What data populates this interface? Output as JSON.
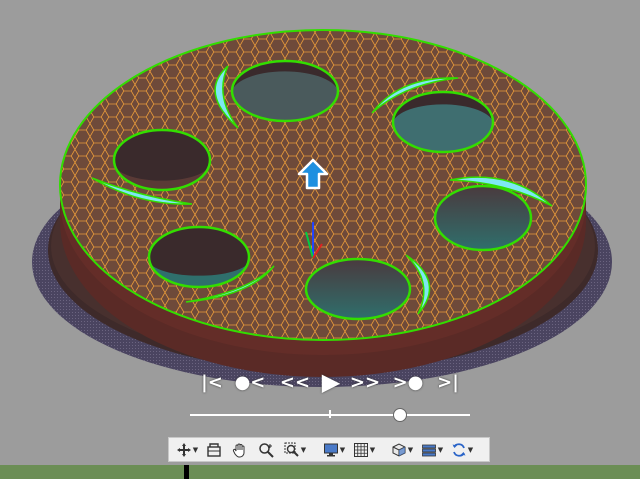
{
  "viewport": {
    "background": "#9c9c9c",
    "model": {
      "body_color": "#5a2a26",
      "mesh_line_color": "#e89a3a",
      "outline_color": "#33dd00",
      "highlight_color": "#7ee8f2",
      "shadow_color": "#4a4460"
    },
    "orientation_arrow_icon": "arrow-up-icon"
  },
  "playback": {
    "controls": [
      {
        "name": "go-to-start-button",
        "icon": "skip-to-start-icon",
        "glyph": "|<"
      },
      {
        "name": "previous-key-button",
        "icon": "previous-key-icon",
        "glyph": "●<"
      },
      {
        "name": "rewind-button",
        "icon": "rewind-icon",
        "glyph": "<<"
      },
      {
        "name": "play-button",
        "icon": "play-icon",
        "glyph": "▶"
      },
      {
        "name": "fast-forward-button",
        "icon": "fast-forward-icon",
        "glyph": ">>"
      },
      {
        "name": "next-key-button",
        "icon": "next-key-icon",
        "glyph": ">●"
      },
      {
        "name": "go-to-end-button",
        "icon": "skip-to-end-icon",
        "glyph": ">|"
      }
    ],
    "position": 0.75
  },
  "toolbar": {
    "buttons": [
      {
        "name": "pan-orbit-button",
        "icon": "move-icon",
        "has_menu": true
      },
      {
        "name": "section-view-button",
        "icon": "section-box-icon",
        "has_menu": false
      },
      {
        "name": "pan-button",
        "icon": "hand-icon",
        "has_menu": false
      },
      {
        "name": "zoom-button",
        "icon": "zoom-icon",
        "has_menu": false
      },
      {
        "name": "zoom-window-button",
        "icon": "zoom-window-icon",
        "has_menu": true
      },
      {
        "name": "display-mode-button",
        "icon": "monitor-icon",
        "has_menu": true
      },
      {
        "name": "grid-button",
        "icon": "grid-icon",
        "has_menu": true
      },
      {
        "name": "view-cube-button",
        "icon": "cube-view-icon",
        "has_menu": true
      },
      {
        "name": "layers-button",
        "icon": "layers-icon",
        "has_menu": true
      },
      {
        "name": "refresh-button",
        "icon": "refresh-icon",
        "has_menu": true
      }
    ]
  },
  "statusbar": {
    "color": "#6b8e55"
  }
}
